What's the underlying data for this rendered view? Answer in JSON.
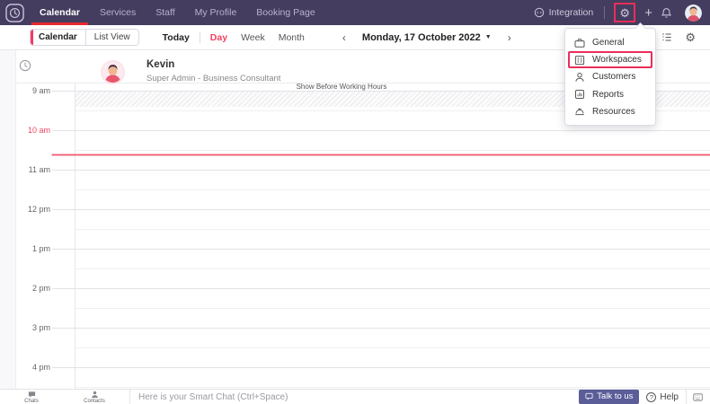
{
  "topnav": {
    "tabs": [
      {
        "label": "Calendar",
        "active": true
      },
      {
        "label": "Services",
        "active": false
      },
      {
        "label": "Staff",
        "active": false
      },
      {
        "label": "My Profile",
        "active": false
      },
      {
        "label": "Booking Page",
        "active": false
      }
    ],
    "integration_label": "Integration",
    "icons": [
      "logo-clock-icon",
      "integration-icon",
      "gear-icon",
      "plus-icon",
      "bell-icon",
      "user-avatar"
    ]
  },
  "toolbar": {
    "view_toggle": [
      {
        "label": "Calendar",
        "active": true
      },
      {
        "label": "List View",
        "active": false
      }
    ],
    "today_label": "Today",
    "range_tabs": [
      {
        "label": "Day",
        "active": true
      },
      {
        "label": "Week",
        "active": false
      },
      {
        "label": "Month",
        "active": false
      }
    ],
    "prev_chevron": "‹",
    "next_chevron": "›",
    "date_label": "Monday, 17 October 2022",
    "right_icons": [
      "agenda-list-icon",
      "gear-icon"
    ]
  },
  "settings_menu": {
    "items": [
      {
        "label": "General",
        "icon": "briefcase-icon",
        "highlighted": false
      },
      {
        "label": "Workspaces",
        "icon": "workspaces-icon",
        "highlighted": true
      },
      {
        "label": "Customers",
        "icon": "person-icon",
        "highlighted": false
      },
      {
        "label": "Reports",
        "icon": "report-icon",
        "highlighted": false
      },
      {
        "label": "Resources",
        "icon": "hardhat-icon",
        "highlighted": false
      }
    ]
  },
  "staff": {
    "name": "Kevin",
    "role": "Super Admin - Business Consultant"
  },
  "calendar": {
    "show_before_label": "Show Before Working Hours",
    "times": [
      "9 am",
      "10 am",
      "11 am",
      "12 pm",
      "1 pm",
      "2 pm",
      "3 pm",
      "4 pm"
    ],
    "highlight_time": "10 am"
  },
  "bottombar": {
    "chats_label": "Chats",
    "contacts_label": "Contacts",
    "smart_chat_placeholder": "Here is your Smart Chat (Ctrl+Space)",
    "talk_to_us_label": "Talk to us",
    "help_label": "Help",
    "help_icon_glyph": "?"
  },
  "colors": {
    "header_purple": "#443d5f",
    "tab_underline_red": "#e6282e",
    "accent_pink": "#f0425f",
    "annotation_red": "#ea2e5a",
    "talk_button_purple": "#5b5d99"
  }
}
